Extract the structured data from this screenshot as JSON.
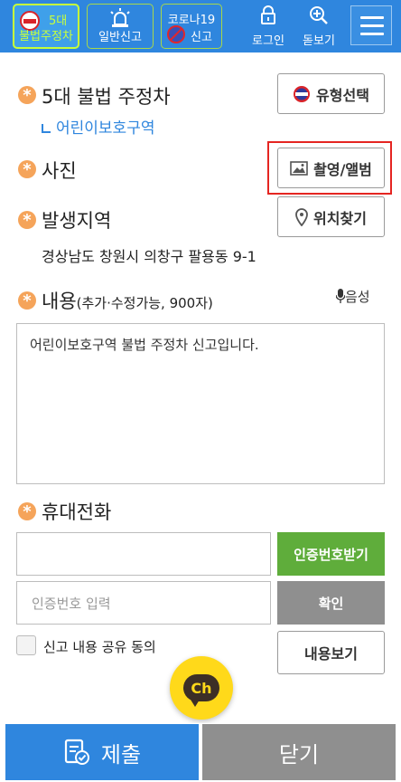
{
  "topbar": {
    "btn1": {
      "line1": "5대",
      "line2": "불법주정차"
    },
    "btn2": {
      "label": "일반신고"
    },
    "btn3": {
      "line1": "코로나19",
      "line2": "신고"
    },
    "login": "로그인",
    "zoom": "돋보기",
    "icons": {
      "btn1": "no-parking-icon",
      "btn2": "siren-icon",
      "btn3": "no-virus-icon",
      "login": "lock-icon",
      "zoom": "magnifier-plus-icon",
      "menu": "hamburger-icon"
    }
  },
  "type_section": {
    "title": "5대 불법 주정차",
    "type_button": "유형선택",
    "sub_link": "어린이보호구역"
  },
  "photo_section": {
    "title": "사진",
    "button": "촬영/앨범"
  },
  "location_section": {
    "title": "발생지역",
    "button": "위치찾기",
    "address": "경상남도 창원시 의창구 팔용동 9-1"
  },
  "content_section": {
    "title": "내용",
    "title_note": "(추가·수정가능, 900자)",
    "voice_button": "음성",
    "text": "어린이보호구역 불법 주정차 신고입니다."
  },
  "phone_section": {
    "title": "휴대전화",
    "phone_value": "",
    "request_code_button": "인증번호받기",
    "code_placeholder": "인증번호 입력",
    "confirm_button": "확인"
  },
  "consent": {
    "label": "신고 내용 공유 동의",
    "view_button": "내용보기"
  },
  "channel_button": "Ch",
  "bottom": {
    "submit": "제출",
    "close": "닫기"
  },
  "colors": {
    "primary": "#2f86de",
    "accent_orange": "#f5a45a",
    "green": "#5fad3b",
    "grey": "#8f8f8f",
    "highlight_red": "#e52521",
    "channel_yellow": "#ffd91a"
  }
}
